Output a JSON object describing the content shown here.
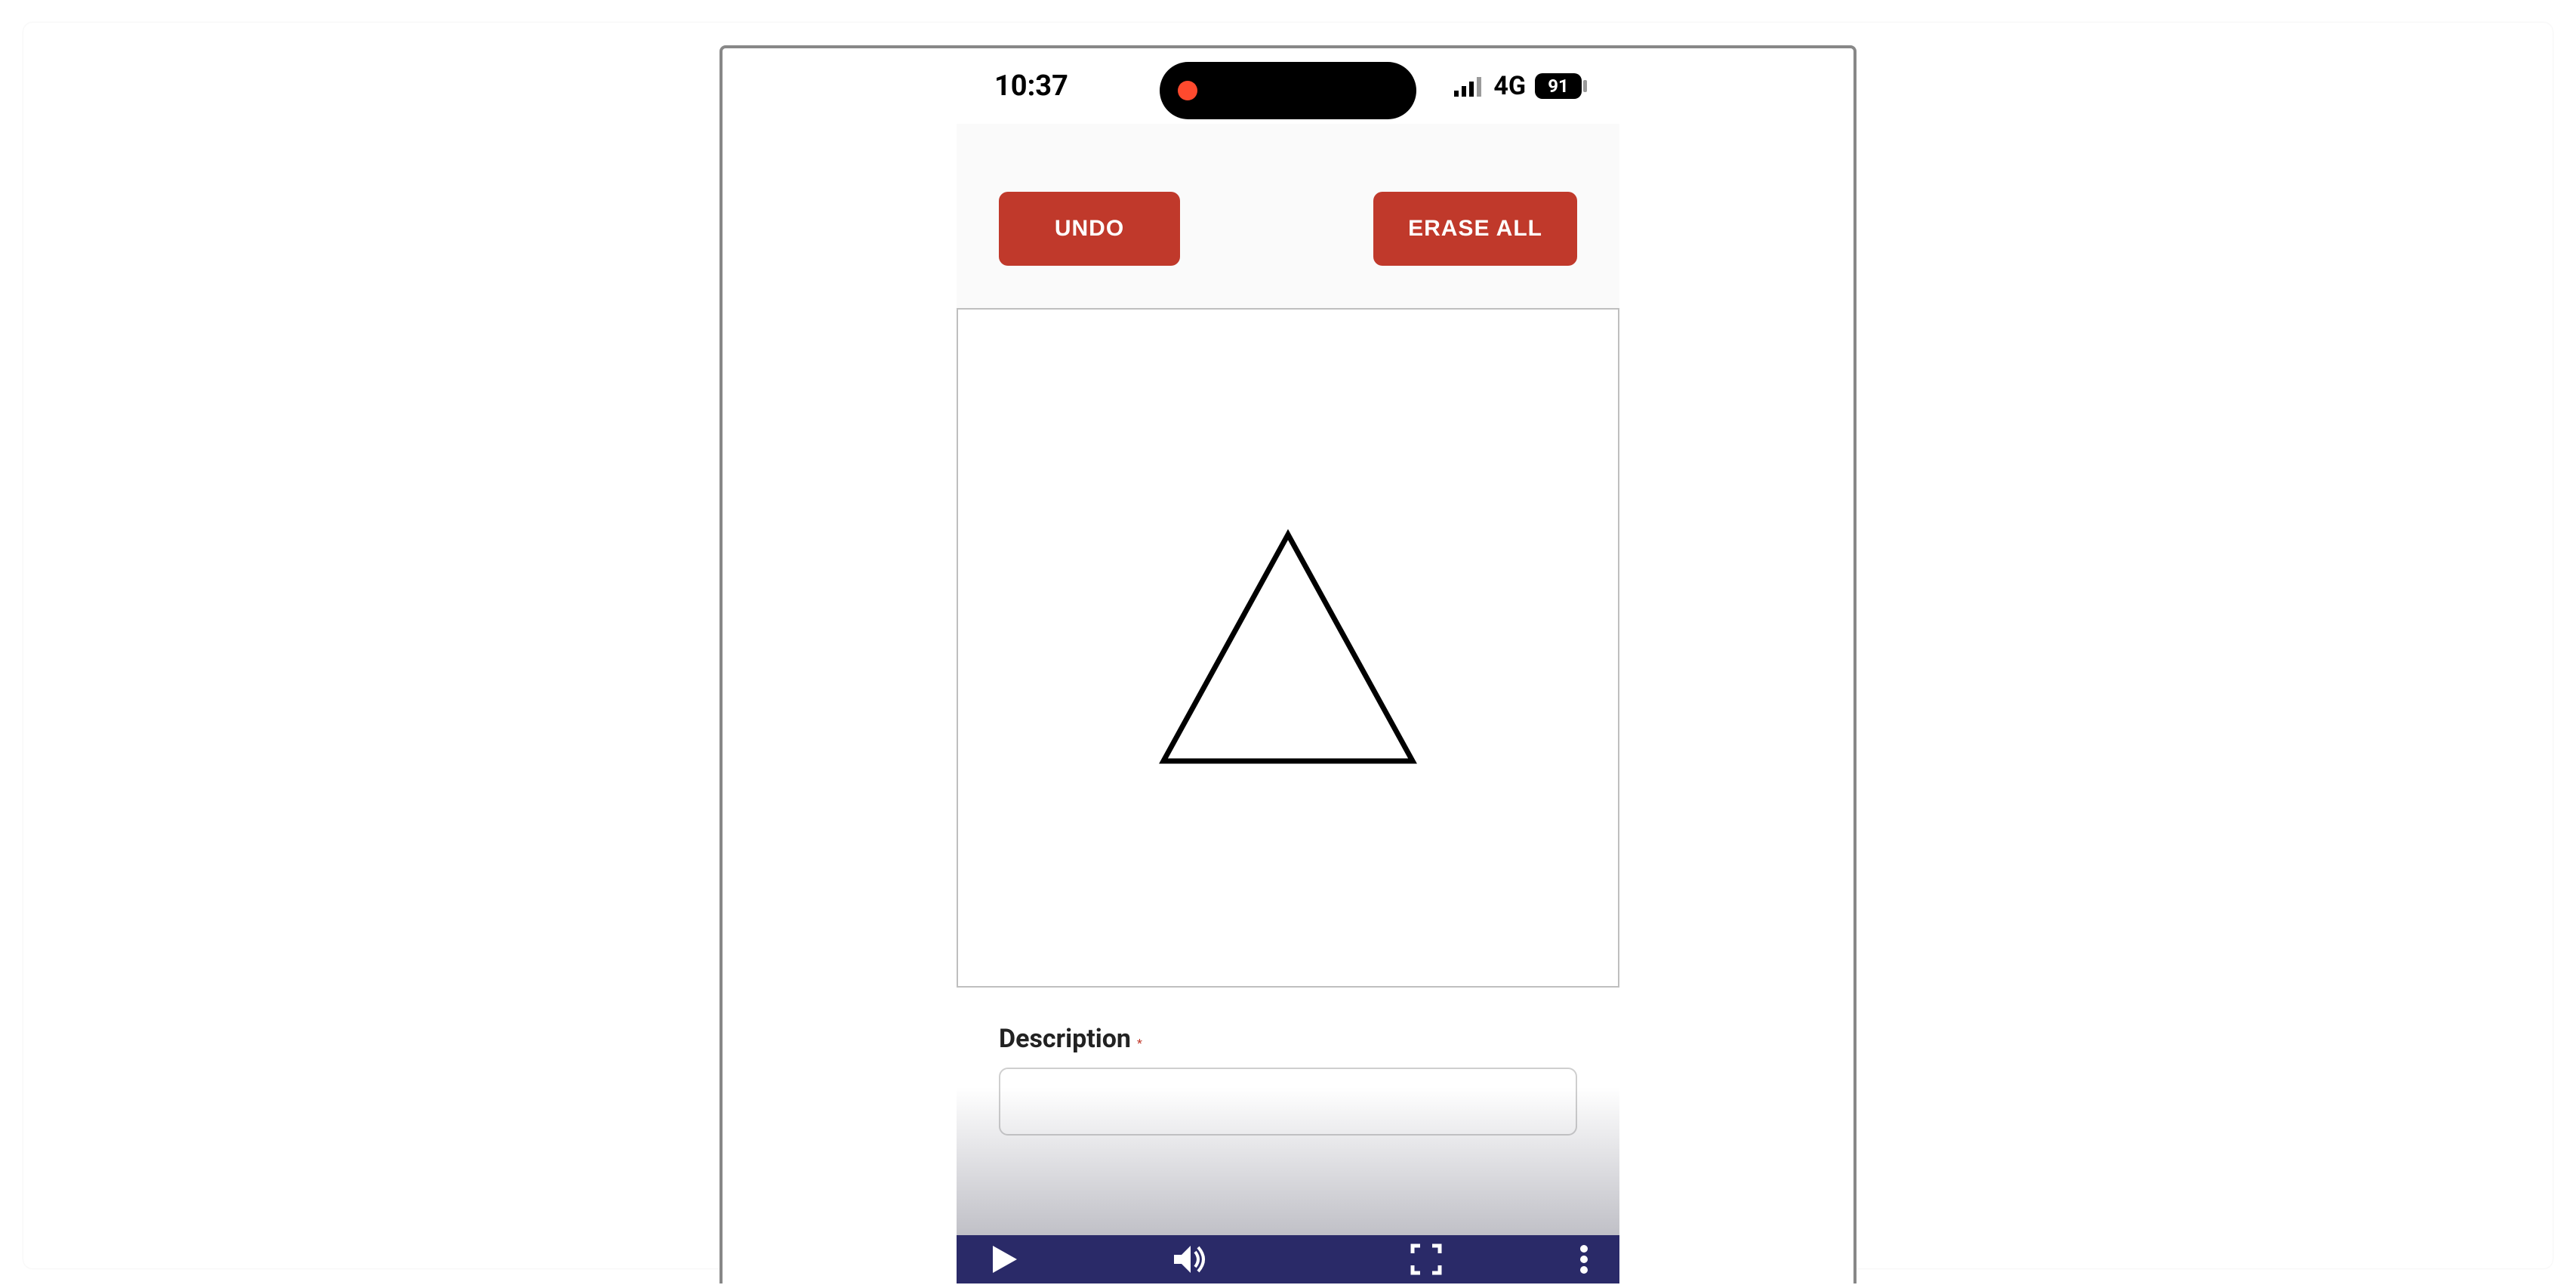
{
  "statusBar": {
    "time": "10:37",
    "networkType": "4G",
    "batteryPercent": "91"
  },
  "toolbar": {
    "undoLabel": "UNDO",
    "eraseAllLabel": "ERASE ALL"
  },
  "canvas": {
    "shape": "triangle"
  },
  "form": {
    "descriptionLabel": "Description",
    "requiredMark": "*",
    "descriptionValue": ""
  },
  "colors": {
    "buttonBg": "#c0392b",
    "videoBarBg": "#2a2a68"
  }
}
